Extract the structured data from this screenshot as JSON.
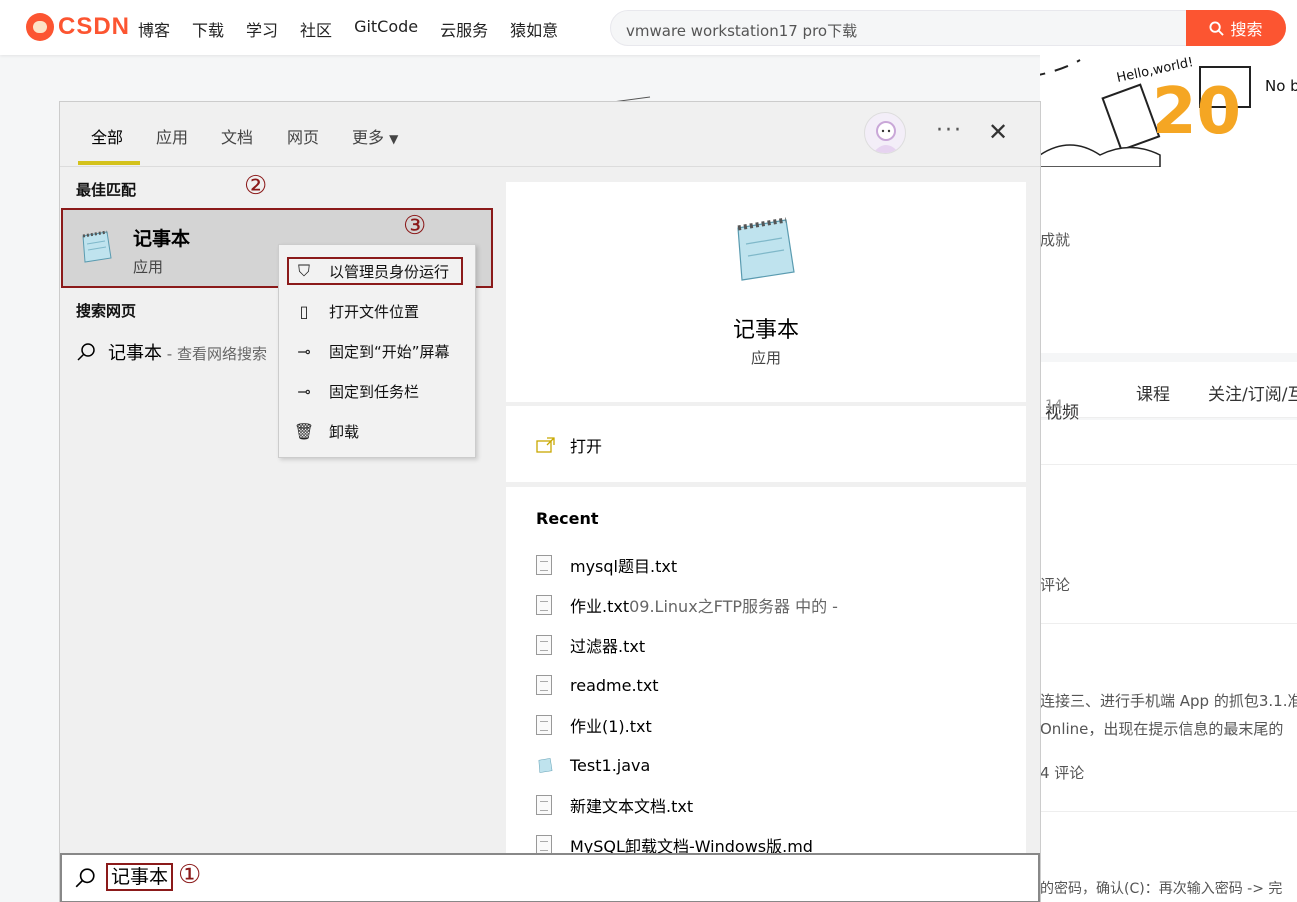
{
  "csdn": {
    "logo_text": "CSDN",
    "nav": [
      "博客",
      "下载",
      "学习",
      "社区",
      "GitCode",
      "云服务",
      "猿如意"
    ],
    "search_placeholder": "vmware workstation17 pro下载",
    "search_button": "搜索"
  },
  "background": {
    "banner_text_1": "Hello,world!",
    "banner_text_2": "No b",
    "banner_number": "20",
    "achievement": "成就",
    "tabs": [
      {
        "label": "视频",
        "count": "14"
      },
      {
        "label": "课程"
      },
      {
        "label": "关注/订阅/互"
      }
    ],
    "comments_1": "评论",
    "snippet_1": "连接三、进行手机端 App 的抓包3.1.准",
    "snippet_2": "Online，出现在提示信息的最末尾的",
    "comments_2": "4 评论",
    "snippet_3": "的密码，确认(C)：再次输入密码 -> 完"
  },
  "win_search": {
    "tabs": [
      "全部",
      "应用",
      "文档",
      "网页",
      "更多"
    ],
    "more_arrow": "▼",
    "dots": "···",
    "close": "✕",
    "best_match_heading": "最佳匹配",
    "best_match": {
      "title": "记事本",
      "subtitle": "应用"
    },
    "web_heading": "搜索网页",
    "web_result": {
      "query": "记事本",
      "hint": " - 查看网络搜索"
    },
    "context_menu": [
      {
        "icon": "shield-icon",
        "label": "以管理员身份运行"
      },
      {
        "icon": "folder-icon",
        "label": "打开文件位置"
      },
      {
        "icon": "pin-icon",
        "label": "固定到“开始”屏幕"
      },
      {
        "icon": "pin-icon",
        "label": "固定到任务栏"
      },
      {
        "icon": "trash-icon",
        "label": "卸载"
      }
    ],
    "detail": {
      "title": "记事本",
      "subtitle": "应用",
      "open_label": "打开"
    },
    "recent_heading": "Recent",
    "recent": [
      {
        "name": "mysql题目.txt",
        "extra": "",
        "icon": "text-file-icon"
      },
      {
        "name": "作业.txt",
        "extra": "09.Linux之FTP服务器 中的 -",
        "icon": "text-file-icon"
      },
      {
        "name": "过滤器.txt",
        "extra": "",
        "icon": "text-file-icon"
      },
      {
        "name": "readme.txt",
        "extra": "",
        "icon": "text-file-icon"
      },
      {
        "name": "作业(1).txt",
        "extra": "",
        "icon": "text-file-icon"
      },
      {
        "name": "Test1.java",
        "extra": "",
        "icon": "notepad-icon"
      },
      {
        "name": "新建文本文档.txt",
        "extra": "",
        "icon": "text-file-icon"
      },
      {
        "name": "MySQL卸载文档-Windows版.md",
        "extra": "",
        "icon": "text-file-icon"
      }
    ],
    "search_query": "记事本"
  },
  "annotations": {
    "step1": "①",
    "step2": "②",
    "step3": "③"
  },
  "colors": {
    "csdn_red": "#fc5531",
    "annotation_red": "#8b1a1a",
    "tab_underline": "#d4c21c"
  }
}
